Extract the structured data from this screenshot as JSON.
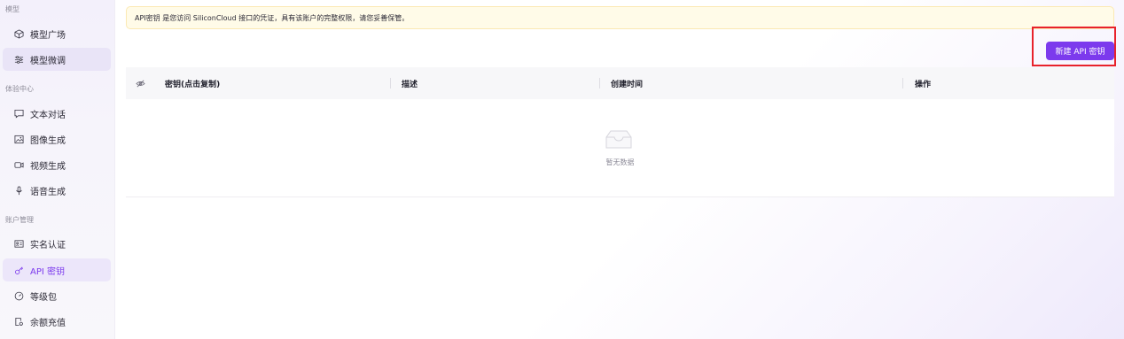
{
  "sidebar": {
    "sections": [
      {
        "label": "模型"
      },
      {
        "label": "体验中心"
      },
      {
        "label": "账户管理"
      }
    ],
    "items": [
      {
        "label": "模型广场",
        "icon": "cube-icon"
      },
      {
        "label": "模型微调",
        "icon": "sliders-icon"
      },
      {
        "label": "文本对话",
        "icon": "chat-icon"
      },
      {
        "label": "图像生成",
        "icon": "image-icon"
      },
      {
        "label": "视频生成",
        "icon": "video-icon"
      },
      {
        "label": "语音生成",
        "icon": "microphone-icon"
      },
      {
        "label": "实名认证",
        "icon": "id-card-icon"
      },
      {
        "label": "API 密钥",
        "icon": "key-icon"
      },
      {
        "label": "等级包",
        "icon": "gauge-icon"
      },
      {
        "label": "余额充值",
        "icon": "wallet-icon"
      }
    ],
    "active_item": "API 密钥"
  },
  "notice": {
    "text": "API密钥 是您访问 SiliconCloud 接口的凭证，具有该账户的完整权限，请您妥善保管。"
  },
  "toolbar": {
    "new_key_label": "新建 API 密钥"
  },
  "table": {
    "columns": [
      {
        "label": "密钥(点击复制)"
      },
      {
        "label": "描述"
      },
      {
        "label": "创建时间"
      },
      {
        "label": "操作"
      }
    ],
    "rows": [],
    "empty_text": "暂无数据"
  },
  "colors": {
    "accent": "#7c3aed",
    "highlight_box": "#e8222b",
    "notice_bg": "#fffbe8"
  }
}
